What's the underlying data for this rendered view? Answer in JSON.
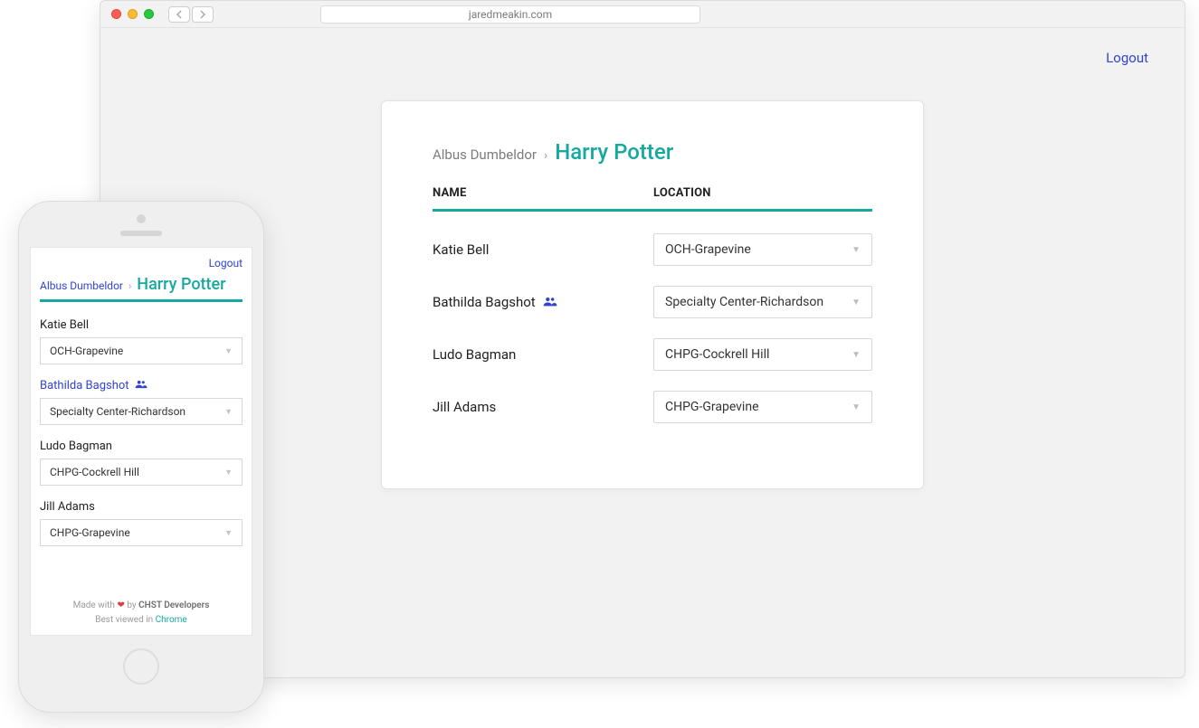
{
  "url": "jaredmeakin.com",
  "logout_label": "Logout",
  "breadcrumb": {
    "parent": "Albus Dumbeldor",
    "current": "Harry Potter"
  },
  "table": {
    "header_name": "NAME",
    "header_location": "LOCATION",
    "rows": [
      {
        "name": "Katie Bell",
        "location": "OCH-Grapevine",
        "group": false
      },
      {
        "name": "Bathilda Bagshot",
        "location": "Specialty Center-Richardson",
        "group": true
      },
      {
        "name": "Ludo Bagman",
        "location": "CHPG-Cockrell Hill",
        "group": false
      },
      {
        "name": "Jill Adams",
        "location": "CHPG-Grapevine",
        "group": false
      }
    ]
  },
  "footer": {
    "made_prefix": "Made with",
    "made_suffix": "by",
    "team": "CHST Developers",
    "viewed_prefix": "Best viewed in",
    "browser": "Chrome"
  }
}
